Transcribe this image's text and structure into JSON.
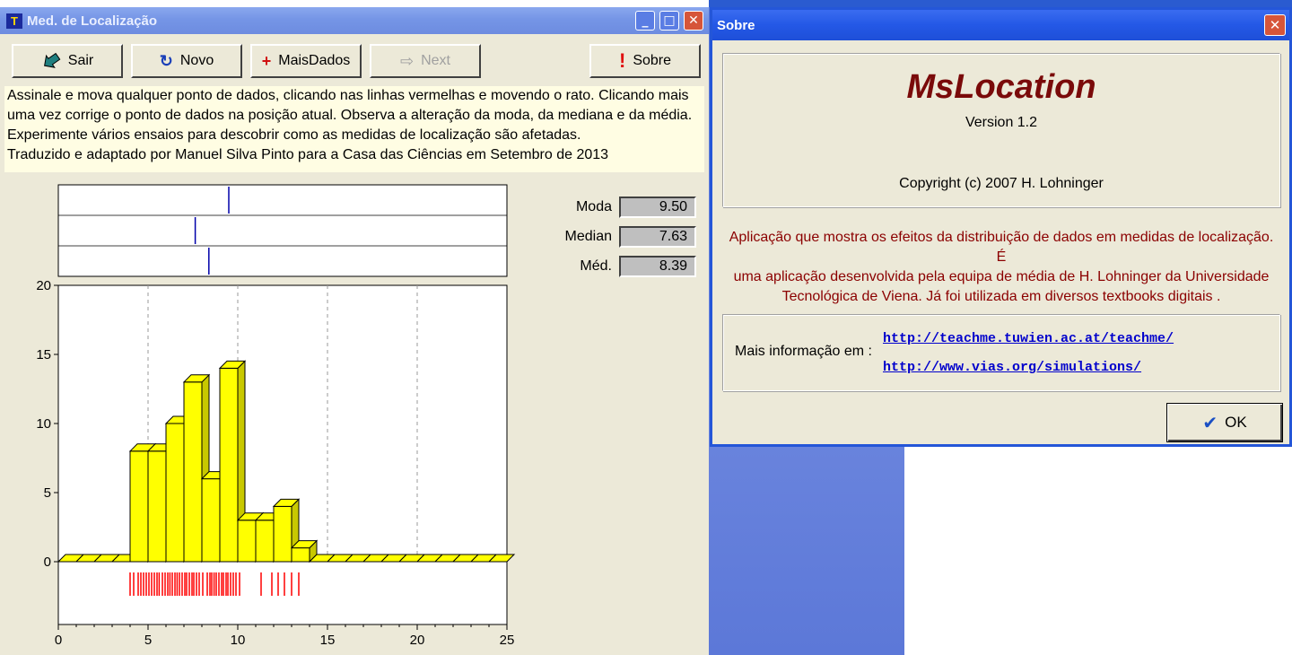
{
  "main_window": {
    "title": "Med. de Localização",
    "toolbar": {
      "sair": "Sair",
      "novo": "Novo",
      "mais_dados": "MaisDados",
      "next": "Next",
      "sobre": "Sobre"
    },
    "instructions": [
      "Assinale e mova qualquer ponto de dados, clicando nas linhas vermelhas e movendo o rato. Clicando mais",
      "uma vez corrige o ponto de dados na posição atual. Observa a alteração da moda, da mediana e da média.",
      "Experimente vários ensaios para descobrir como as medidas de localização são afetadas.",
      "Traduzido e adaptado por Manuel Silva Pinto para a Casa das Ciências em Setembro de 2013"
    ],
    "stats": {
      "moda_label": "Moda",
      "moda_value": "9.50",
      "median_label": "Median",
      "median_value": "7.63",
      "med_label": "Méd.",
      "med_value": "8.39"
    }
  },
  "chart_data": {
    "type": "bar",
    "x_ticks": [
      "0",
      "5",
      "10",
      "15",
      "20",
      "25"
    ],
    "y_ticks": [
      "0",
      "5",
      "10",
      "15",
      "20"
    ],
    "xlim": [
      0,
      25
    ],
    "ylim": [
      0,
      20
    ],
    "bin_width": 1,
    "bin_starts": [
      0,
      1,
      2,
      3,
      4,
      5,
      6,
      7,
      8,
      9,
      10,
      11,
      12,
      13,
      14,
      15,
      16,
      17,
      18,
      19,
      20,
      21,
      22,
      23,
      24
    ],
    "values": [
      0,
      0,
      0,
      0,
      8,
      8,
      10,
      13,
      6,
      14,
      3,
      3,
      4,
      1,
      0,
      0,
      0,
      0,
      0,
      0,
      0,
      0,
      0,
      0,
      0
    ],
    "markers": {
      "moda": 9.5,
      "median": 7.63,
      "mean": 8.39
    },
    "data_points": [
      4.0,
      4.2,
      4.45,
      4.6,
      4.75,
      4.9,
      5.05,
      5.2,
      5.35,
      5.5,
      5.62,
      5.8,
      5.95,
      6.1,
      6.22,
      6.35,
      6.5,
      6.62,
      6.75,
      6.9,
      7.05,
      7.15,
      7.3,
      7.45,
      7.55,
      7.7,
      7.85,
      8.05,
      8.3,
      8.45,
      8.55,
      8.68,
      8.8,
      8.95,
      9.1,
      9.2,
      9.35,
      9.45,
      9.6,
      9.75,
      9.9,
      10.1,
      11.3,
      11.9,
      12.25,
      12.6,
      13.0,
      13.4
    ],
    "grid": "vertical dashed at 5, 10, 15, 20",
    "colors": {
      "bar": "#ffff00",
      "bar_side": "#c8c800",
      "marker": "#0000aa",
      "points": "#ff0000"
    }
  },
  "about_dialog": {
    "title": "Sobre",
    "app_name": "MsLocation",
    "version": "Version 1.2",
    "copyright": "Copyright (c) 2007 H. Lohninger",
    "description": [
      "Aplicação que mostra os efeitos da distribuição de dados em medidas de localização. É",
      "uma aplicação desenvolvida pela equipa de média de H. Lohninger da Universidade",
      "Tecnológica de Viena. Já foi utilizada em diversos textbooks digitais          ."
    ],
    "more_info_label": "Mais informação em :",
    "link1": "http://teachme.tuwien.ac.at/teachme/",
    "link2": "http://www.vias.org/simulations/",
    "ok_label": "OK"
  },
  "icons": [
    "app-icon",
    "exit-arrow-icon",
    "refresh-icon",
    "plus-icon",
    "next-arrow-icon",
    "exclamation-icon",
    "minimize-icon",
    "maximize-icon",
    "close-icon",
    "checkmark-icon"
  ]
}
